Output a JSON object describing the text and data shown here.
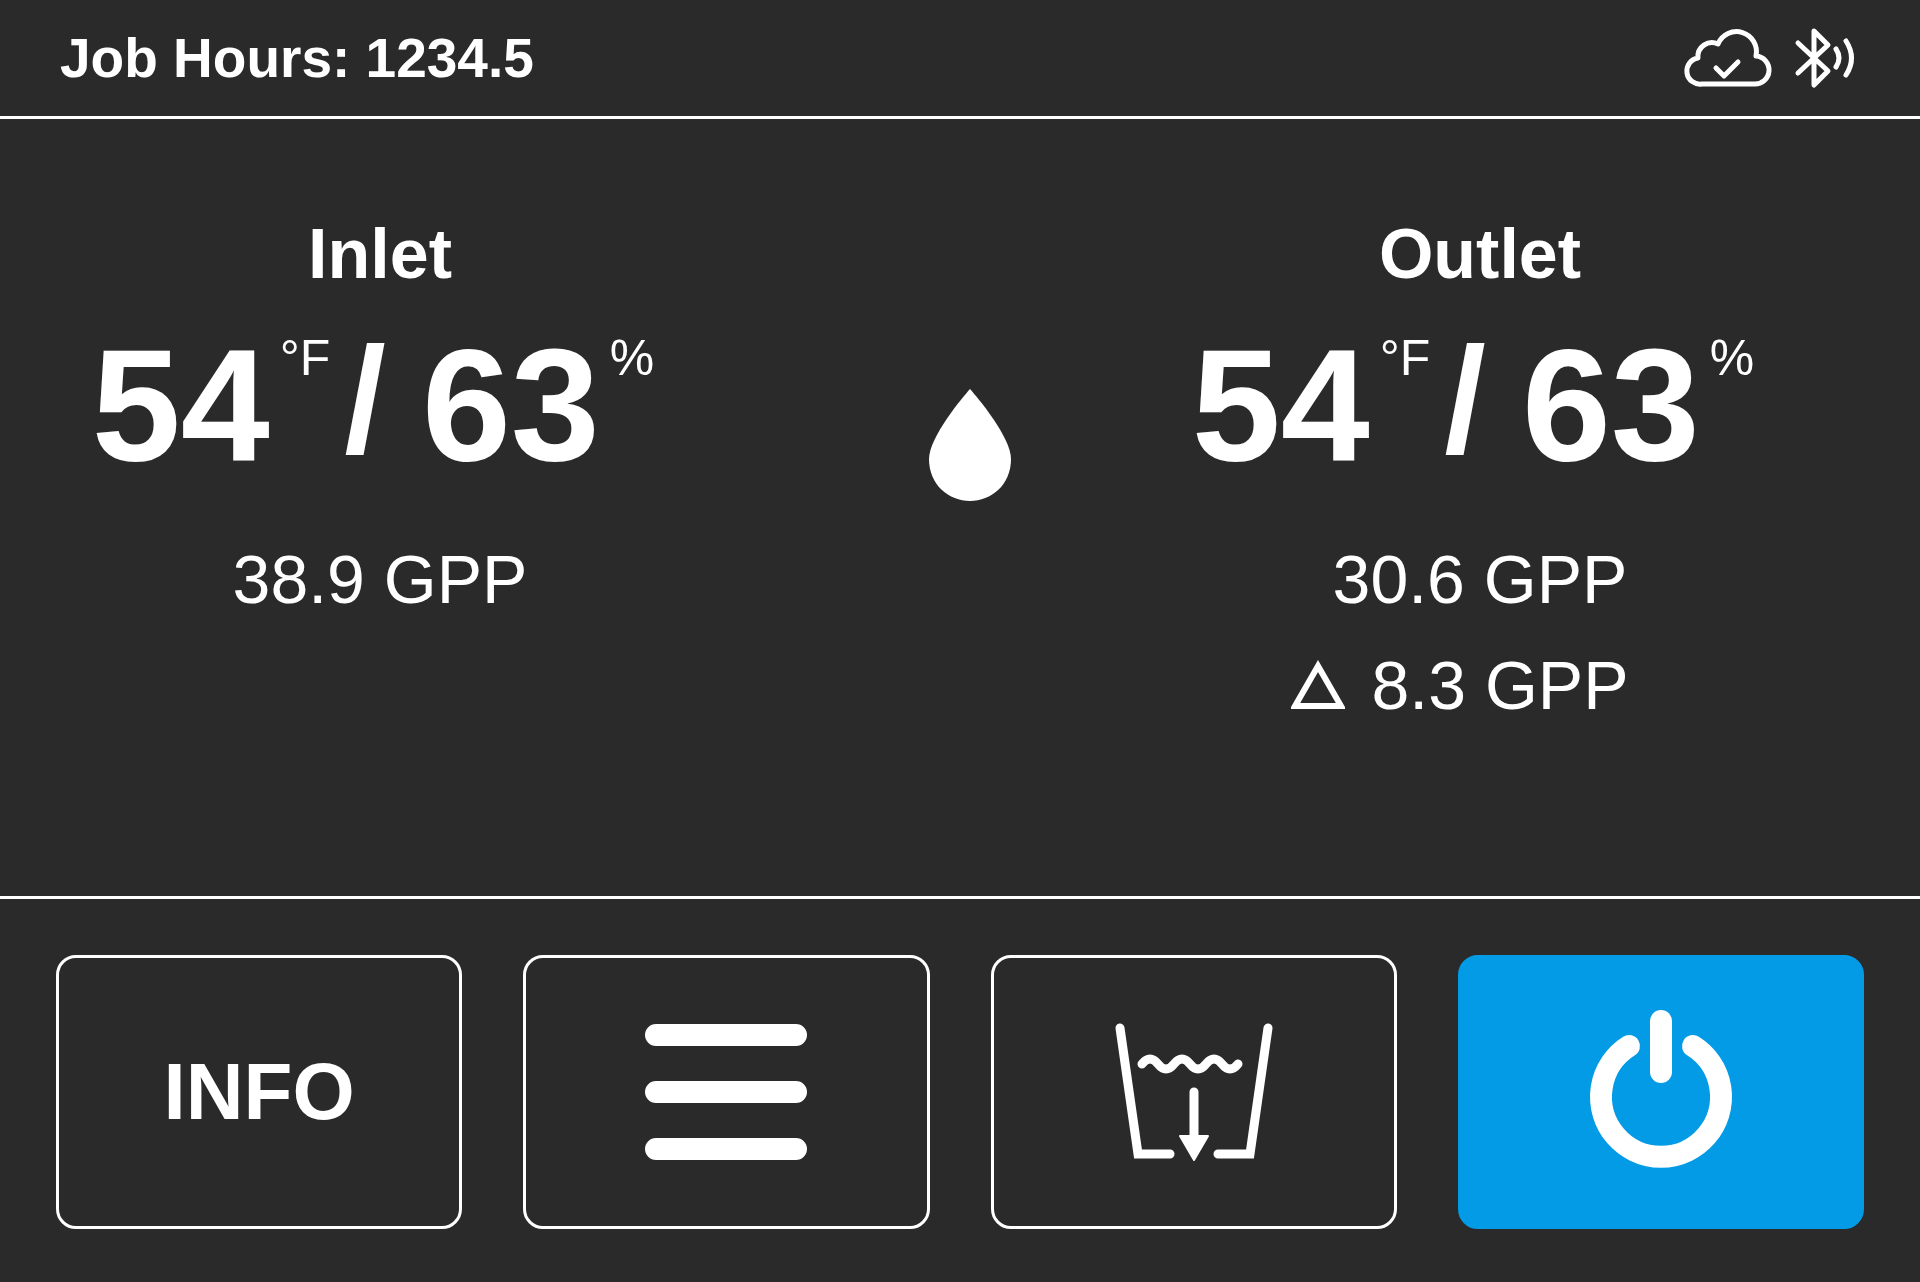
{
  "header": {
    "job_hours": "Job Hours: 1234.5"
  },
  "sensors": [
    {
      "title": "Inlet",
      "temperature": "54",
      "temperature_unit": "°F",
      "separator": "/",
      "humidity": "63",
      "humidity_unit": "%",
      "gpp": "38.9 GPP"
    },
    {
      "title": "Outlet",
      "temperature": "54",
      "temperature_unit": "°F",
      "separator": "/",
      "humidity": "63",
      "humidity_unit": "%",
      "gpp": "30.6 GPP",
      "delta": "8.3 GPP"
    }
  ],
  "buttons": [
    {
      "kind": "text",
      "label": "INFO",
      "on": false
    },
    {
      "kind": "menu",
      "on": false
    },
    {
      "kind": "drain",
      "on": false
    },
    {
      "kind": "power",
      "on": true
    }
  ]
}
